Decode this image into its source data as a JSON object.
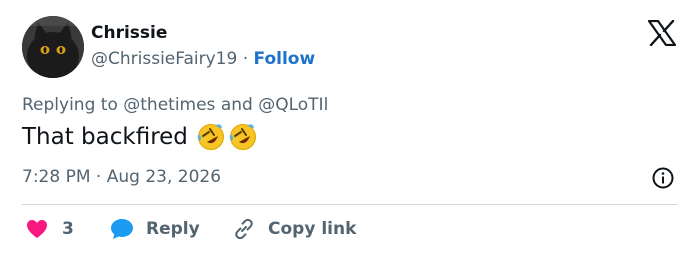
{
  "author": {
    "display_name": "Chrissie",
    "handle": "@ChrissieFairy19",
    "separator": "·",
    "follow_label": "Follow"
  },
  "reply_context": {
    "prefix": "Replying to",
    "mentions": [
      "@thetimes",
      "@QLoTIl"
    ],
    "joiner": "and"
  },
  "tweet": {
    "text": "That backfired",
    "emojis": [
      "rolling-on-floor-laughing-emoji",
      "rolling-on-floor-laughing-emoji"
    ]
  },
  "meta": {
    "time": "7:28 PM",
    "separator": "·",
    "date": "Aug 23, 2026"
  },
  "actions": {
    "like_count": "3",
    "reply_label": "Reply",
    "copy_label": "Copy link"
  },
  "colors": {
    "like": "#f91880",
    "reply": "#1d9bf0",
    "follow": "#1d73c9",
    "secondary_text": "#536471"
  },
  "icons": [
    "x-logo-icon",
    "info-icon",
    "heart-icon",
    "reply-bubble-icon",
    "link-icon"
  ]
}
